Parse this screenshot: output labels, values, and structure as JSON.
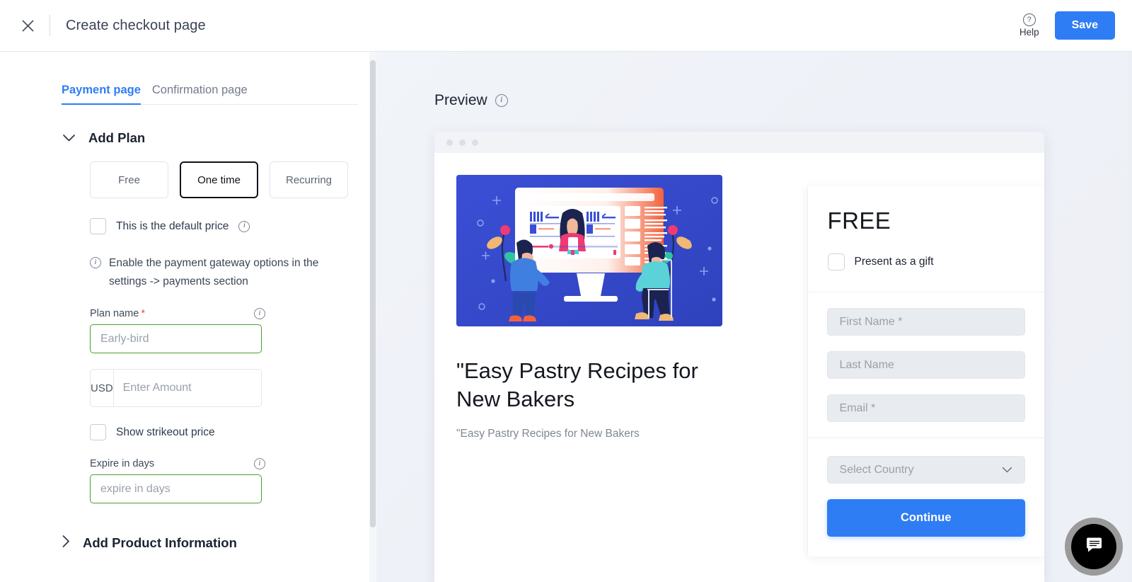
{
  "topbar": {
    "close_icon": "close-icon",
    "title": "Create checkout page",
    "help_label": "Help",
    "help_icon": "question-mark-icon",
    "save_label": "Save",
    "accent_color": "#2f7df4"
  },
  "sidebar": {
    "tabs": [
      {
        "label": "Payment page",
        "active": true
      },
      {
        "label": "Confirmation page",
        "active": false
      }
    ],
    "add_plan": {
      "title": "Add Plan",
      "expanded": true,
      "chevron_icon": "chevron-down-icon",
      "plan_types": [
        {
          "label": "Free",
          "selected": false
        },
        {
          "label": "One time",
          "selected": true
        },
        {
          "label": "Recurring",
          "selected": false
        }
      ],
      "default_price": {
        "label": "This is the default price",
        "checked": false,
        "info_icon": "info-icon"
      },
      "gateway_hint": "Enable the payment gateway options in the settings -> payments section",
      "gateway_hint_icon": "info-icon",
      "plan_name": {
        "label": "Plan name",
        "required_mark": "*",
        "placeholder": "Early-bird",
        "value": "",
        "info_icon": "info-icon",
        "border_color": "#4a9e2f"
      },
      "amount": {
        "currency": "USD",
        "placeholder": "Enter Amount",
        "value": ""
      },
      "strikeout": {
        "label": "Show strikeout price",
        "checked": false
      },
      "expire": {
        "label": "Expire in days",
        "placeholder": "expire in days",
        "value": "",
        "info_icon": "info-icon"
      }
    },
    "add_product_information": {
      "title": "Add Product Information",
      "expanded": false,
      "chevron_icon": "chevron-right-icon"
    }
  },
  "preview": {
    "heading": "Preview",
    "info_icon": "info-icon",
    "browser_dots": 3,
    "product": {
      "image_alt": "people-watching-online-course-illustration",
      "title": "\"Easy Pastry Recipes for New Bakers",
      "subtitle": "\"Easy Pastry Recipes for New Bakers"
    },
    "checkout": {
      "price": "FREE",
      "gift": {
        "label": "Present as a gift",
        "checked": false
      },
      "fields": [
        {
          "name": "first-name-field",
          "placeholder": "First Name *",
          "value": ""
        },
        {
          "name": "last-name-field",
          "placeholder": "Last Name",
          "value": ""
        },
        {
          "name": "email-field",
          "placeholder": "Email *",
          "value": ""
        }
      ],
      "country": {
        "placeholder": "Select Country",
        "value": "",
        "chevron_icon": "chevron-down-icon"
      },
      "continue_label": "Continue",
      "button_color": "#2f7df4"
    }
  },
  "chat_widget": {
    "icon": "chat-bubble-icon"
  }
}
